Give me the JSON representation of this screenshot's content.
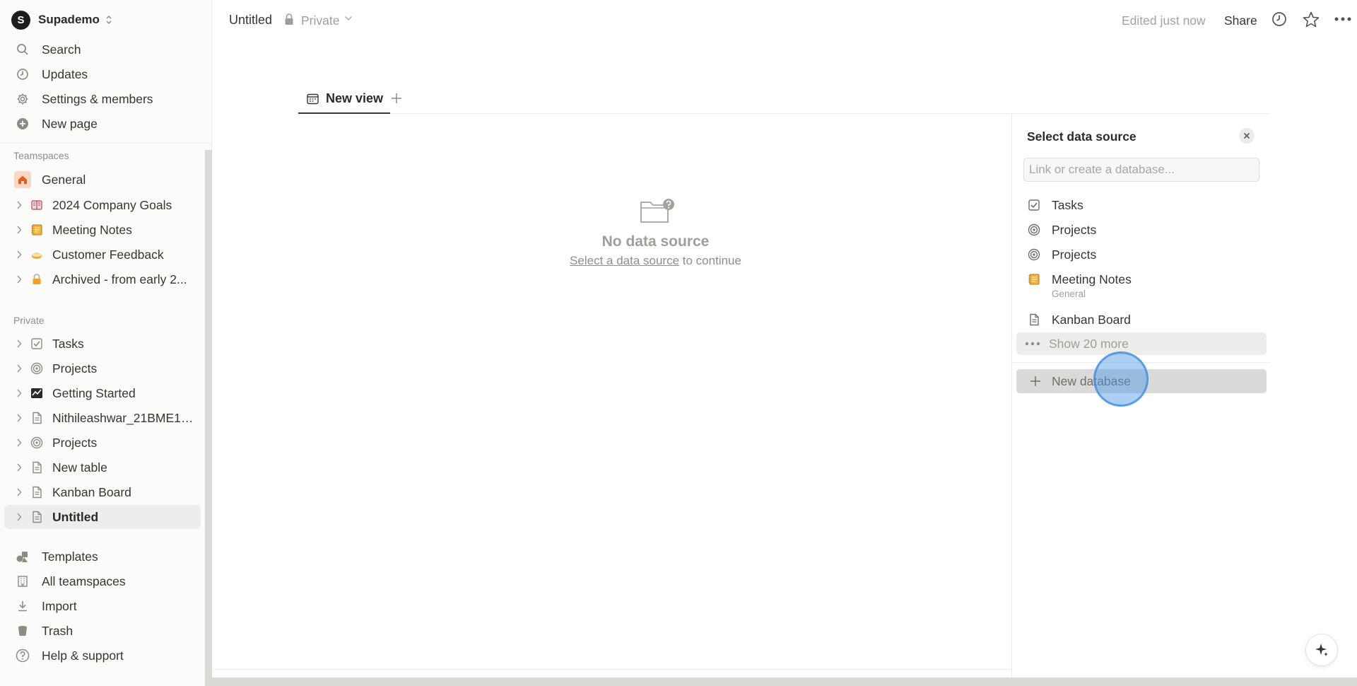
{
  "workspace": {
    "logo_letter": "S",
    "name": "Supademo"
  },
  "nav": [
    {
      "label": "Search",
      "icon": "search-icon"
    },
    {
      "label": "Updates",
      "icon": "clock-icon"
    },
    {
      "label": "Settings & members",
      "icon": "gear-icon"
    },
    {
      "label": "New page",
      "icon": "plus-circle-icon"
    }
  ],
  "teamspaces": {
    "title": "Teamspaces",
    "items": [
      {
        "label": "General",
        "icon": "home-icon"
      },
      {
        "label": "2024 Company Goals",
        "icon": "book-icon"
      },
      {
        "label": "Meeting Notes",
        "icon": "notebook-icon"
      },
      {
        "label": "Customer Feedback",
        "icon": "pie-icon"
      },
      {
        "label": "Archived - from early 2...",
        "icon": "lock-icon"
      }
    ]
  },
  "private": {
    "title": "Private",
    "items": [
      {
        "label": "Tasks",
        "icon": "checkbox-icon"
      },
      {
        "label": "Projects",
        "icon": "target-icon"
      },
      {
        "label": "Getting Started",
        "icon": "chart-icon"
      },
      {
        "label": "Nithileashwar_21BME10...",
        "icon": "page-icon"
      },
      {
        "label": "Projects",
        "icon": "target-icon"
      },
      {
        "label": "New table",
        "icon": "page-icon"
      },
      {
        "label": "Kanban Board",
        "icon": "page-icon"
      },
      {
        "label": "Untitled",
        "icon": "page-icon",
        "active": true
      }
    ]
  },
  "footer_nav": [
    {
      "label": "Templates",
      "icon": "shapes-icon"
    },
    {
      "label": "All teamspaces",
      "icon": "building-icon"
    },
    {
      "label": "Import",
      "icon": "download-icon"
    },
    {
      "label": "Trash",
      "icon": "trash-icon"
    },
    {
      "label": "Help & support",
      "icon": "help-icon"
    }
  ],
  "topbar": {
    "breadcrumb": "Untitled",
    "privacy": "Private",
    "edited": "Edited just now",
    "share": "Share"
  },
  "view_tab": {
    "label": "New view"
  },
  "empty_state": {
    "title": "No data source",
    "link": "Select a data source",
    "suffix": "to continue"
  },
  "panel": {
    "title": "Select data source",
    "search_placeholder": "Link or create a database...",
    "options": [
      {
        "label": "Tasks",
        "sub": "",
        "icon": "checkbox-icon"
      },
      {
        "label": "Projects",
        "sub": "",
        "icon": "target-icon"
      },
      {
        "label": "Projects",
        "sub": "",
        "icon": "target-icon"
      },
      {
        "label": "Meeting Notes",
        "sub": "General",
        "icon": "notebook-icon"
      },
      {
        "label": "Kanban Board",
        "sub": "",
        "icon": "page-icon"
      }
    ],
    "show_more": "Show 20 more",
    "new_database": "New database"
  },
  "colors": {
    "sidebar_bg": "#fbfbfa",
    "text": "#37352f",
    "muted": "#9f9e99",
    "highlight": "#ededeb",
    "cursor": "#4696e6"
  }
}
